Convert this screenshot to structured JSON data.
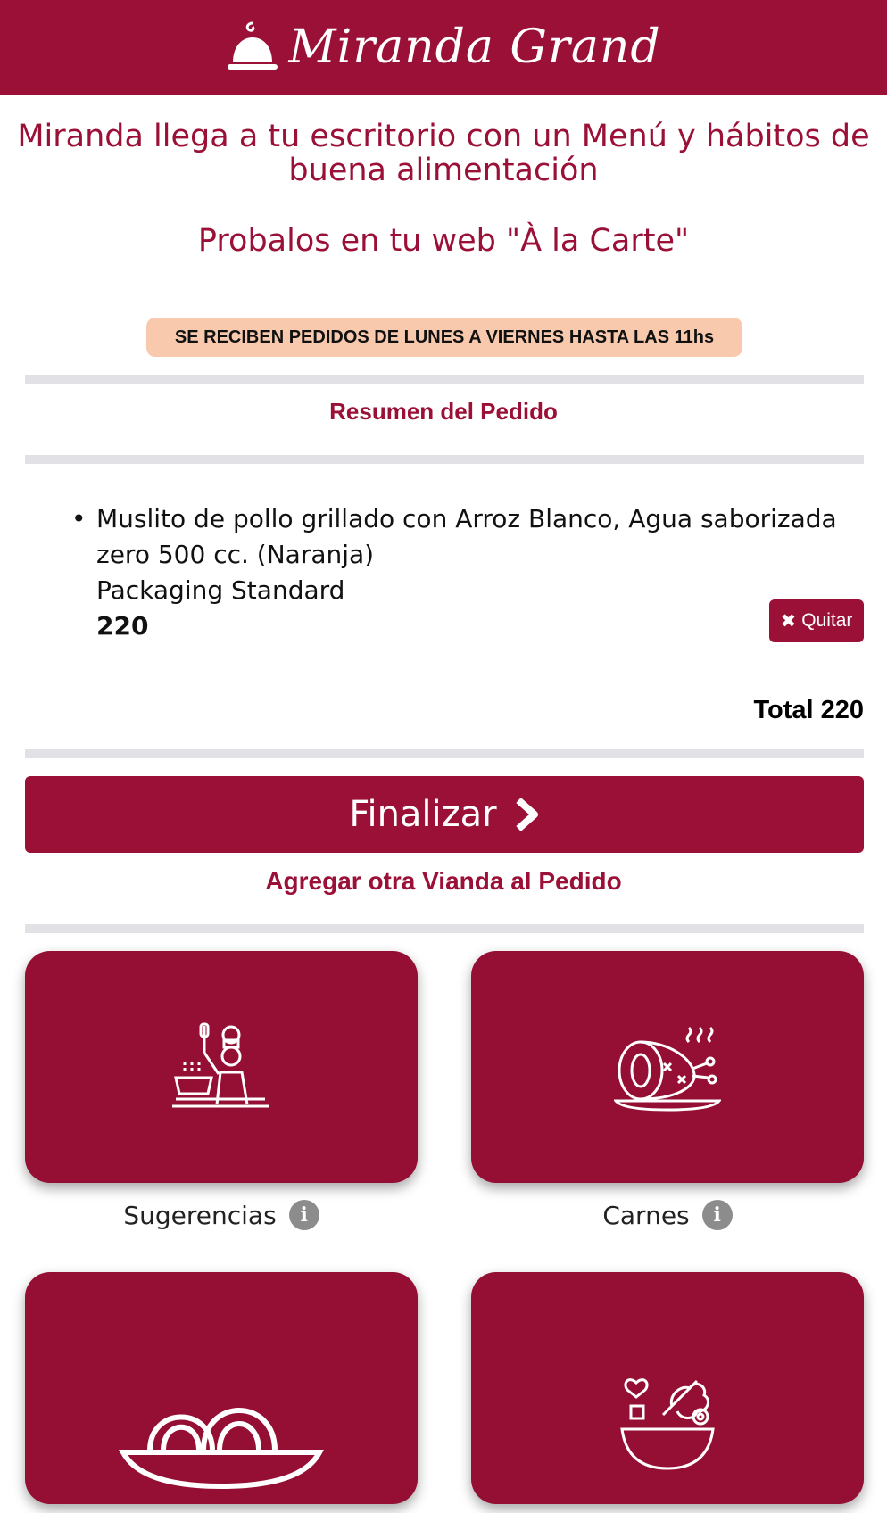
{
  "header": {
    "brand": "Miranda Grand",
    "brand_color": "#9a1036"
  },
  "intro": {
    "tagline": "Miranda llega a tu escritorio con un Menú y hábitos de buena alimentación",
    "subtitle": "Probalos en tu web \"À la Carte\""
  },
  "notice": {
    "text": "SE RECIBEN PEDIDOS DE LUNES A VIERNES HASTA LAS 11hs",
    "bg_color": "#f8c9ad"
  },
  "order": {
    "title": "Resumen del Pedido",
    "items": [
      {
        "description": "Muslito de pollo grillado con Arroz Blanco, Agua saborizada zero 500 cc. (Naranja)",
        "packaging": "Packaging Standard",
        "price": "220",
        "remove_label": "Quitar"
      }
    ],
    "total": "Total 220"
  },
  "actions": {
    "finalize_label": "Finalizar",
    "add_more_label": "Agregar otra Vianda al Pedido"
  },
  "categories": [
    {
      "label": "Sugerencias",
      "icon": "chef-cooking-icon"
    },
    {
      "label": "Carnes",
      "icon": "ham-roast-icon"
    },
    {
      "label": "",
      "icon": "pasta-plate-icon"
    },
    {
      "label": "",
      "icon": "salad-bowl-icon"
    }
  ]
}
